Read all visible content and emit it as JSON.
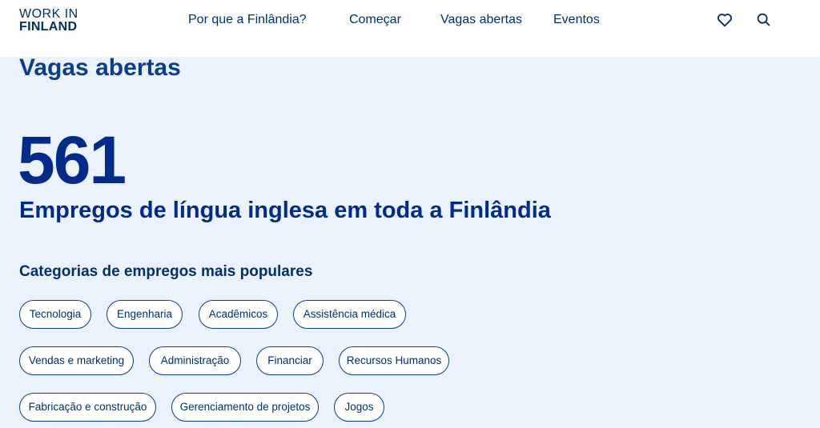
{
  "header": {
    "logo_line1": "WORK IN",
    "logo_line2": "FINLAND",
    "nav": [
      "Por que a Finlândia?",
      "Começar",
      "Vagas abertas",
      "Eventos"
    ],
    "icons": [
      "heart-icon",
      "search-icon"
    ]
  },
  "main": {
    "title": "Vagas abertas",
    "job_count": "561",
    "subtitle": "Empregos de língua inglesa em toda a Finlândia",
    "categories_heading": "Categorias de empregos mais populares",
    "categories": [
      "Tecnologia",
      "Engenharia",
      "Acadêmicos",
      "Assistência médica",
      "Vendas e marketing",
      "Administração",
      "Financiar",
      "Recursos Humanos",
      "Fabricação e construção",
      "Gerenciamento de projetos",
      "Jogos"
    ]
  },
  "colors": {
    "accent": "#002b8a",
    "background": "#eaf3fb",
    "header_bg": "#ffffff"
  }
}
